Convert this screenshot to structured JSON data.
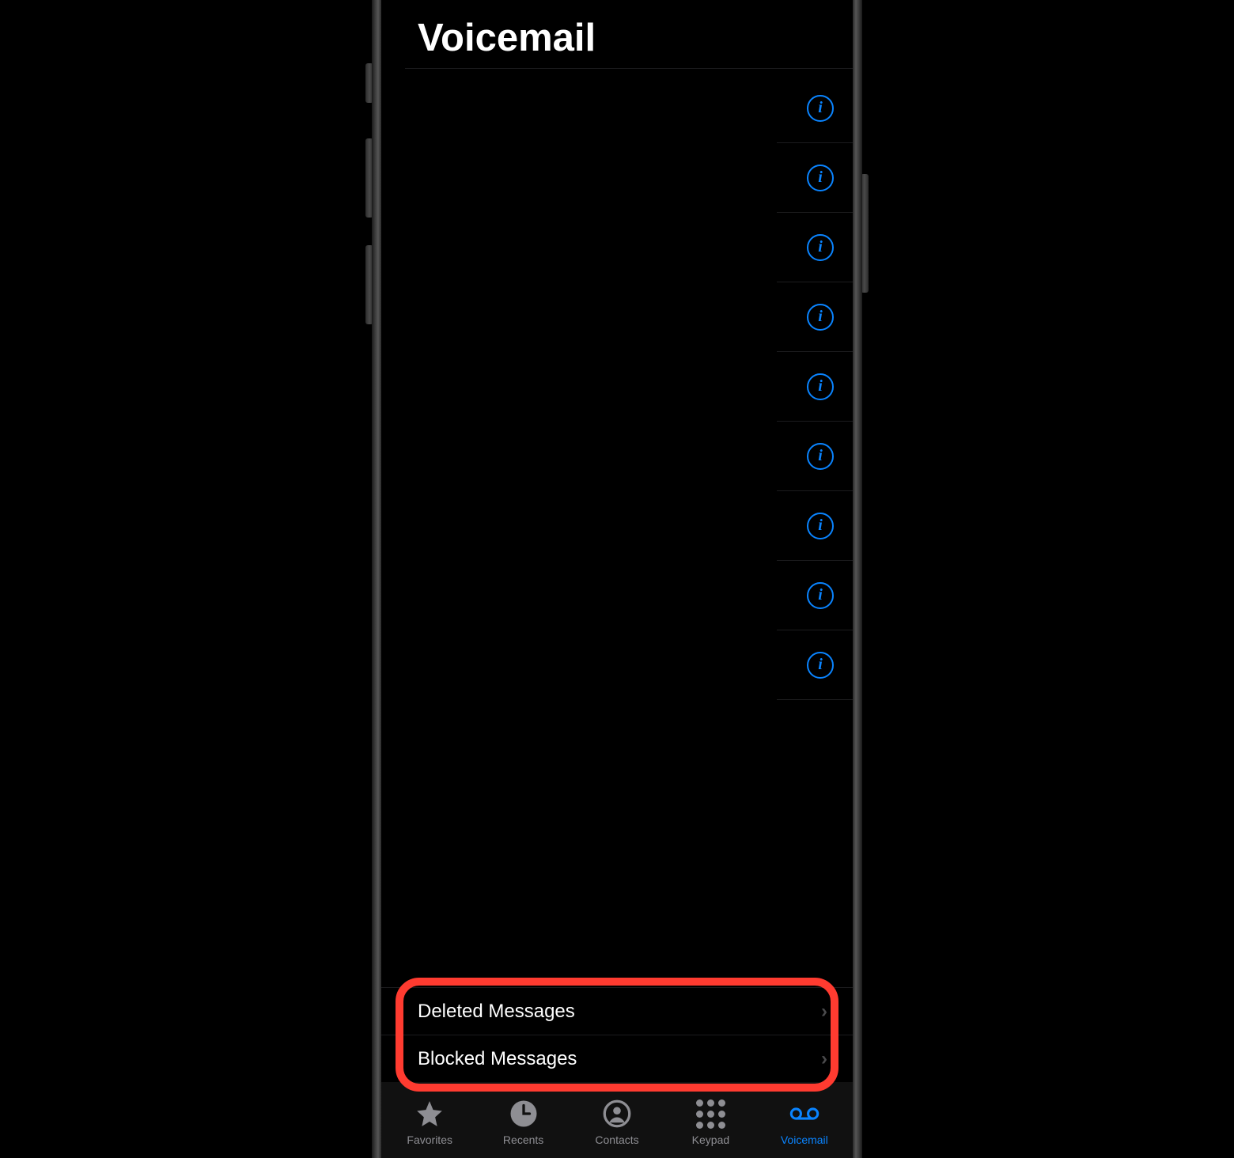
{
  "header": {
    "title": "Voicemail"
  },
  "voicemails": [
    {},
    {},
    {},
    {},
    {},
    {},
    {},
    {},
    {}
  ],
  "menu": {
    "deleted": "Deleted Messages",
    "blocked": "Blocked Messages"
  },
  "tabs": {
    "favorites": "Favorites",
    "recents": "Recents",
    "contacts": "Contacts",
    "keypad": "Keypad",
    "voicemail": "Voicemail"
  },
  "colors": {
    "accent": "#0a84ff",
    "highlight": "#ff3b30",
    "inactive": "#8e8e93"
  }
}
